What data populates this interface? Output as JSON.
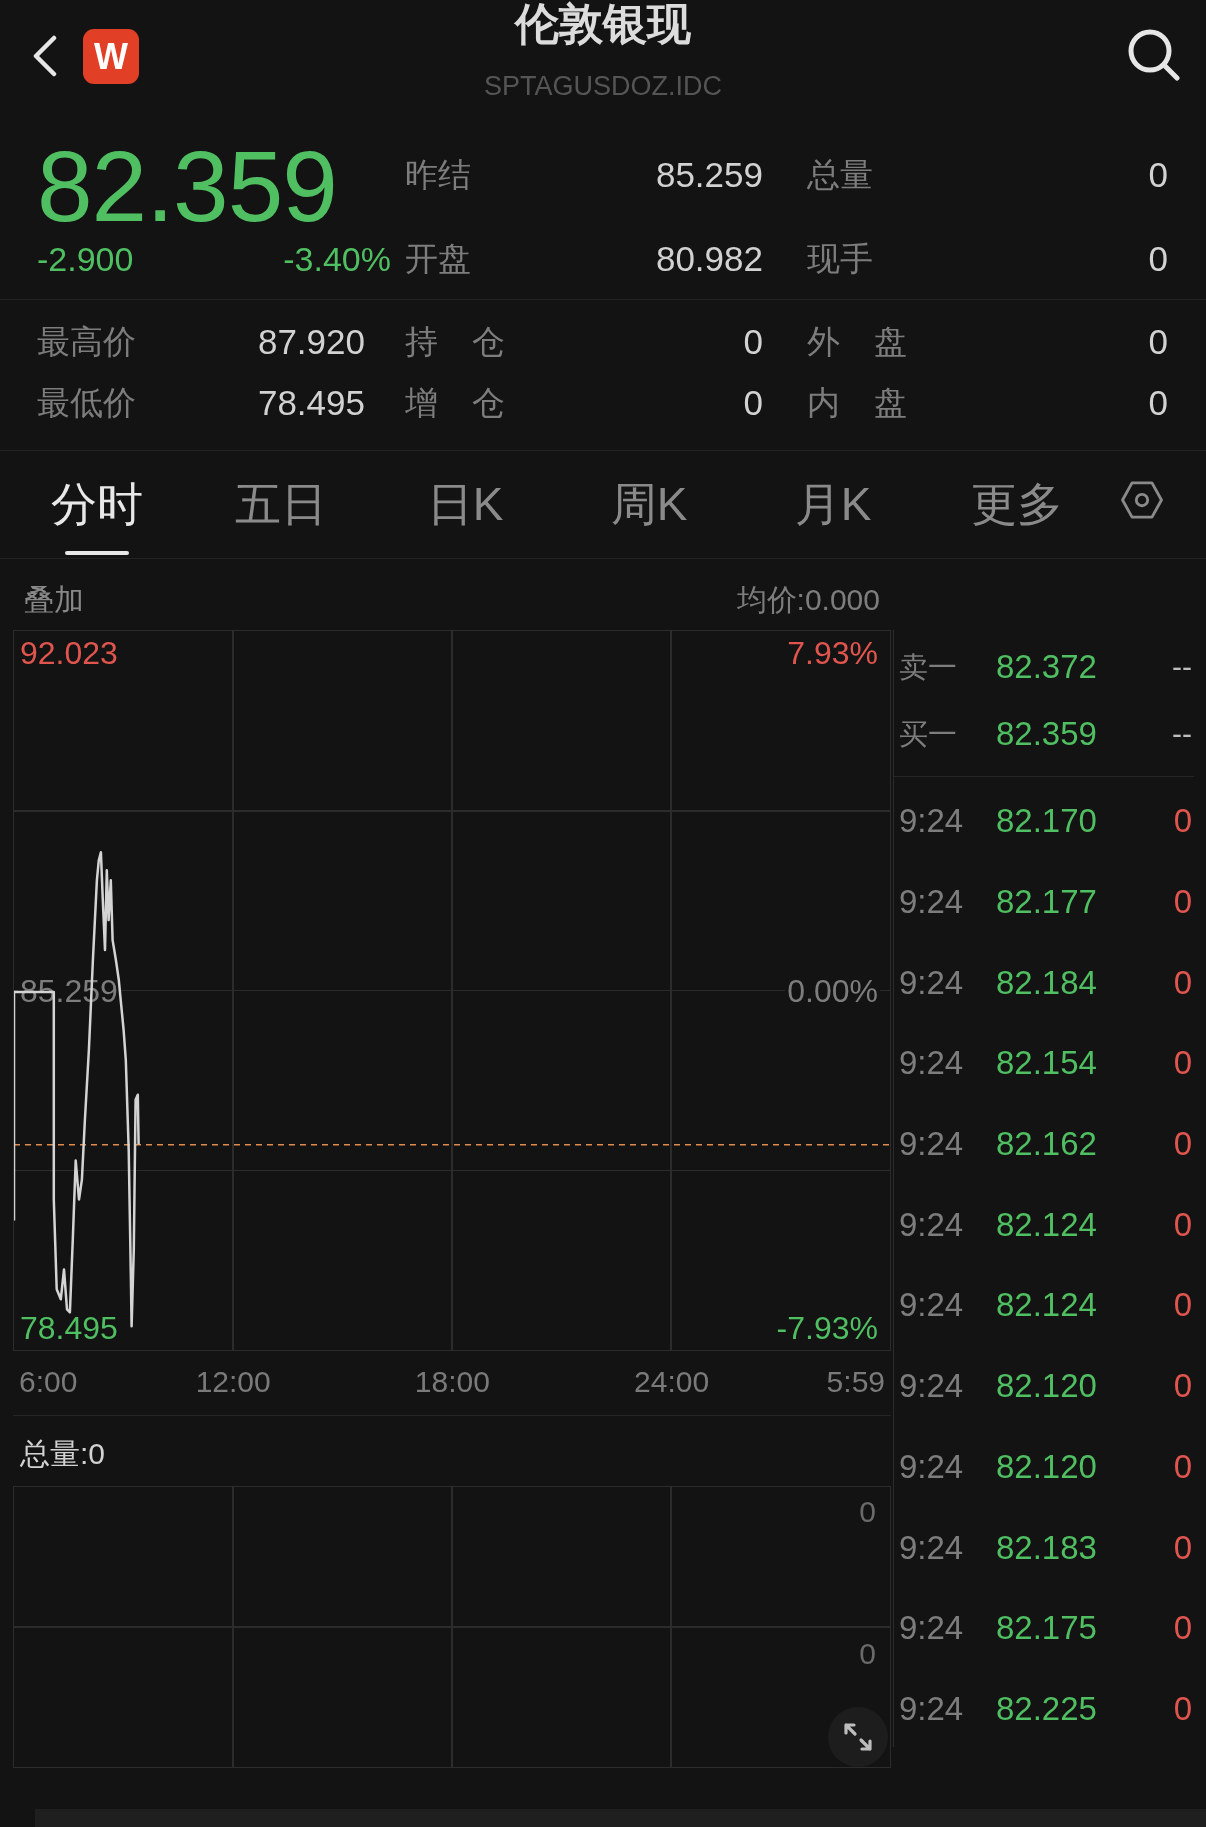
{
  "header": {
    "title": "伦敦银现",
    "symbol": "SPTAGUSDOZ.IDC",
    "logo_text": "W"
  },
  "quote": {
    "price": "82.359",
    "change": "-2.900",
    "change_percent": "-3.40%",
    "rising": false
  },
  "quote_stats": [
    {
      "cells": [
        {
          "label": "昨结",
          "value": "85.259"
        },
        {
          "label": "总量",
          "value": "0"
        }
      ]
    },
    {
      "cells": [
        {
          "label": "开盘",
          "value": "80.982"
        },
        {
          "label": "现手",
          "value": "0"
        }
      ]
    }
  ],
  "range_stats": [
    {
      "cells": [
        {
          "label": "最高价",
          "value": "87.920"
        },
        {
          "label": "持 仓",
          "value": "0"
        },
        {
          "label": "外 盘",
          "value": "0"
        }
      ]
    },
    {
      "cells": [
        {
          "label": "最低价",
          "value": "78.495"
        },
        {
          "label": "增 仓",
          "value": "0"
        },
        {
          "label": "内 盘",
          "value": "0"
        }
      ]
    }
  ],
  "tabs": [
    {
      "label": "分时",
      "selected": true
    },
    {
      "label": "五日",
      "selected": false
    },
    {
      "label": "日K",
      "selected": false
    },
    {
      "label": "周K",
      "selected": false
    },
    {
      "label": "月K",
      "selected": false
    },
    {
      "label": "更多",
      "selected": false
    }
  ],
  "intraday": {
    "overlay": "叠加",
    "average_price": "均价:0.000",
    "percent_labels": [
      {
        "text": "7.93%",
        "color": "#e0554e"
      },
      {
        "text": "0.00%",
        "color": "#7d7d7d"
      },
      {
        "text": "-7.93%",
        "color": "#4fbf62"
      }
    ],
    "axis_end_label": "5:59",
    "chart_data": {
      "type": "line",
      "x": [
        6,
        6,
        7.09,
        7.09,
        7.17,
        7.28,
        7.37,
        7.45,
        7.53,
        7.61,
        7.69,
        7.78,
        7.86,
        7.94,
        8.05,
        8.16,
        8.27,
        8.32,
        8.38,
        8.43,
        8.49,
        8.54,
        8.59,
        8.65,
        8.7,
        8.79,
        8.87,
        8.92,
        9.0,
        9.06,
        9.14,
        9.2,
        9.22,
        9.28,
        9.33,
        9.39,
        9.41
      ],
      "series": [
        {
          "color": "#d4d4d4",
          "values": [
            80.65,
            85.23,
            85.23,
            81.07,
            79.27,
            79.07,
            79.67,
            78.87,
            78.81,
            80.27,
            81.85,
            81.07,
            81.47,
            82.67,
            84.07,
            85.87,
            87.47,
            87.87,
            88.03,
            87.07,
            86.07,
            87.67,
            86.67,
            87.47,
            86.27,
            85.87,
            85.47,
            85.07,
            84.47,
            83.87,
            82.07,
            79.47,
            78.53,
            80.07,
            83.07,
            83.17,
            82.17
          ]
        }
      ],
      "xlim": [
        6,
        29.98
      ],
      "ylim": [
        78.054,
        92.464
      ],
      "xticks": [
        {
          "value": 6,
          "label": "6:00"
        },
        {
          "value": 12,
          "label": "12:00"
        },
        {
          "value": 18,
          "label": "18:00"
        },
        {
          "value": 24,
          "label": "24:00"
        }
      ],
      "yticks": [
        {
          "value": 92.023,
          "label": "92.023"
        },
        {
          "value": 85.259,
          "label": "85.259"
        },
        {
          "value": 78.495,
          "label": "78.495"
        }
      ],
      "ref_lines": [
        {
          "axis": "y",
          "value": 82.17
        }
      ]
    }
  },
  "volume": {
    "total": "总量:0",
    "axis_labels": [
      "0",
      "0"
    ]
  },
  "order_book": [
    {
      "label": "卖一",
      "price": "82.372",
      "volume": "--"
    },
    {
      "label": "买一",
      "price": "82.359",
      "volume": "--"
    }
  ],
  "trades": [
    {
      "time": "9:24",
      "price": "82.170",
      "volume": "0"
    },
    {
      "time": "9:24",
      "price": "82.177",
      "volume": "0"
    },
    {
      "time": "9:24",
      "price": "82.184",
      "volume": "0"
    },
    {
      "time": "9:24",
      "price": "82.154",
      "volume": "0"
    },
    {
      "time": "9:24",
      "price": "82.162",
      "volume": "0"
    },
    {
      "time": "9:24",
      "price": "82.124",
      "volume": "0"
    },
    {
      "time": "9:24",
      "price": "82.124",
      "volume": "0"
    },
    {
      "time": "9:24",
      "price": "82.120",
      "volume": "0"
    },
    {
      "time": "9:24",
      "price": "82.120",
      "volume": "0"
    },
    {
      "time": "9:24",
      "price": "82.183",
      "volume": "0"
    },
    {
      "time": "9:24",
      "price": "82.175",
      "volume": "0"
    },
    {
      "time": "9:24",
      "price": "82.225",
      "volume": "0"
    }
  ]
}
